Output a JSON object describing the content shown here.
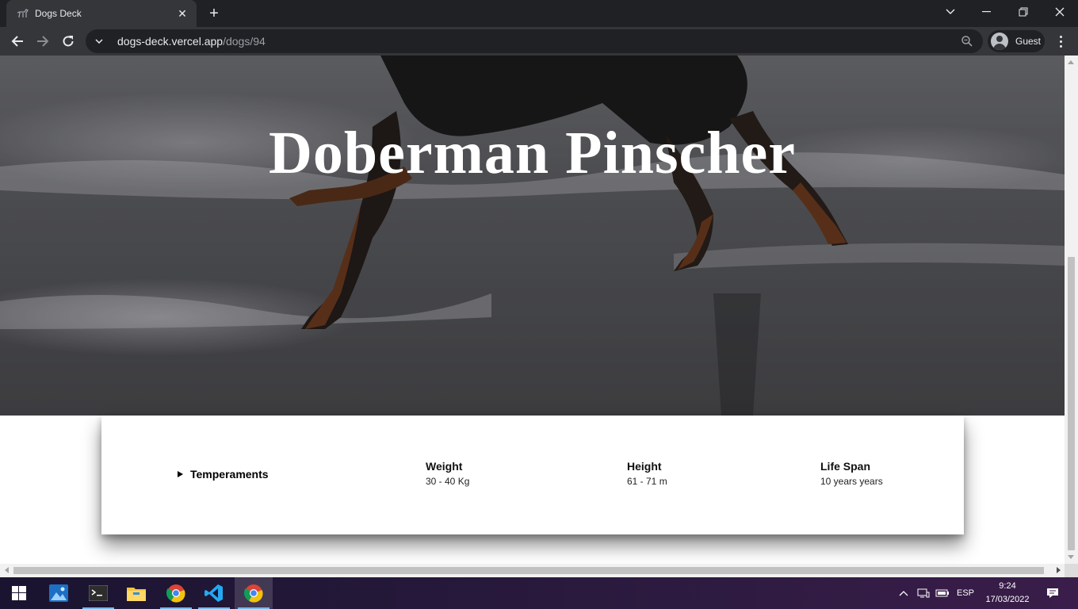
{
  "browser": {
    "tab_title": "Dogs Deck",
    "url_host": "dogs-deck.vercel.app",
    "url_path": "/dogs/94",
    "profile_label": "Guest"
  },
  "page": {
    "breed_name": "Doberman Pinscher",
    "temperaments_label": "Temperaments",
    "stats": [
      {
        "label": "Weight",
        "value": "30 - 40 Kg"
      },
      {
        "label": "Height",
        "value": "61 - 71 m"
      },
      {
        "label": "Life Span",
        "value": "10 years years"
      }
    ]
  },
  "taskbar": {
    "apps": [
      "start-icon",
      "photos-icon",
      "terminal-icon",
      "file-explorer-icon",
      "chrome-icon",
      "vscode-icon",
      "chrome-icon"
    ],
    "language": "ESP",
    "time": "9:24",
    "date": "17/03/2022"
  },
  "colors": {
    "chrome_dark": "#202124",
    "chrome_toolbar": "#35363a",
    "card_bg": "#ffffff"
  }
}
